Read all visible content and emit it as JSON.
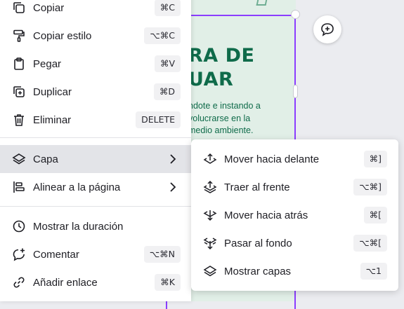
{
  "design": {
    "heading": "RA DE\nUAR",
    "body": "ndote e instando a\nvolucrarse en la\nmedio ambiente."
  },
  "context_menu": {
    "items": [
      {
        "label": "Copiar",
        "shortcut": "⌘C"
      },
      {
        "label": "Copiar estilo",
        "shortcut": "⌥⌘C"
      },
      {
        "label": "Pegar",
        "shortcut": "⌘V"
      },
      {
        "label": "Duplicar",
        "shortcut": "⌘D"
      },
      {
        "label": "Eliminar",
        "shortcut": "DELETE"
      },
      {
        "label": "Capa"
      },
      {
        "label": "Alinear a la página"
      },
      {
        "label": "Mostrar la duración"
      },
      {
        "label": "Comentar",
        "shortcut": "⌥⌘N"
      },
      {
        "label": "Añadir enlace",
        "shortcut": "⌘K"
      }
    ]
  },
  "layer_submenu": {
    "items": [
      {
        "label": "Mover hacia delante",
        "shortcut": "⌘]"
      },
      {
        "label": "Traer al frente",
        "shortcut": "⌥⌘]"
      },
      {
        "label": "Mover hacia atrás",
        "shortcut": "⌘["
      },
      {
        "label": "Pasar al fondo",
        "shortcut": "⌥⌘["
      },
      {
        "label": "Mostrar capas",
        "shortcut": "⌥1"
      }
    ]
  },
  "colors": {
    "selection": "#8b3dff",
    "design_text": "#0f6b4a",
    "active_row": "#e3e4e8"
  }
}
